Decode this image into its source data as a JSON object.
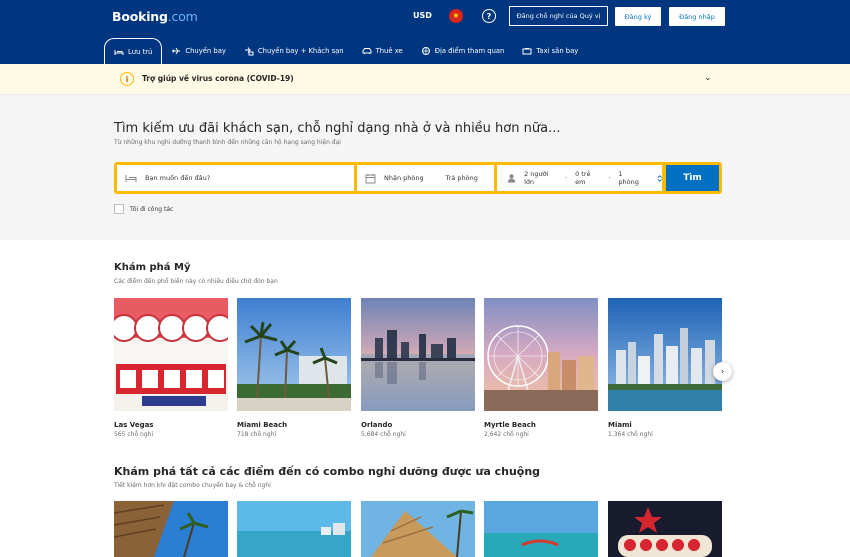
{
  "header": {
    "logo_main": "Booking",
    "logo_dot": ".com",
    "currency": "USD",
    "flag_glyph": "★",
    "help_glyph": "?",
    "list_property": "Đăng chỗ nghỉ của Quý vị",
    "register": "Đăng ký",
    "login": "Đăng nhập"
  },
  "nav": [
    {
      "label": "Lưu trú",
      "icon": "bed-icon"
    },
    {
      "label": "Chuyến bay",
      "icon": "plane-icon"
    },
    {
      "label": "Chuyến bay + Khách sạn",
      "icon": "plane-hotel-icon"
    },
    {
      "label": "Thuê xe",
      "icon": "car-icon"
    },
    {
      "label": "Địa điểm tham quan",
      "icon": "attractions-icon"
    },
    {
      "label": "Taxi sân bay",
      "icon": "taxi-icon"
    }
  ],
  "covid": {
    "icon_glyph": "i",
    "text": "Trợ giúp về virus corona (COVID-19)",
    "chevron": "⌄"
  },
  "hero": {
    "title": "Tìm kiếm ưu đãi khách sạn, chỗ nghỉ dạng nhà ở và nhiều hơn nữa...",
    "subtitle": "Từ những khu nghỉ dưỡng thanh bình đến những căn hộ hạng sang hiện đại"
  },
  "search": {
    "destination_placeholder": "Bạn muốn đến đâu?",
    "checkin": "Nhận phòng",
    "checkout": "Trả phòng",
    "adults": "2 người lớn",
    "children": "0 trẻ em",
    "rooms": "1 phòng",
    "separator": "·",
    "button": "Tìm",
    "business_trip": "Tôi đi công tác"
  },
  "explore": {
    "title": "Khám phá Mỹ",
    "subtitle": "Các điểm đến phổ biến này có nhiều điều chờ đón bạn",
    "next_glyph": "›",
    "cards": [
      {
        "name": "Las Vegas",
        "count": "565 chỗ nghỉ"
      },
      {
        "name": "Miami Beach",
        "count": "718 chỗ nghỉ"
      },
      {
        "name": "Orlando",
        "count": "5,684 chỗ nghỉ"
      },
      {
        "name": "Myrtle Beach",
        "count": "2,642 chỗ nghỉ"
      },
      {
        "name": "Miami",
        "count": "1,364 chỗ nghỉ"
      }
    ]
  },
  "combo": {
    "title": "Khám phá tất cả các điểm đến có combo nghỉ dưỡng được ưa chuộng",
    "subtitle": "Tiết kiệm hơn khi đặt combo chuyến bay & chỗ nghỉ"
  },
  "colors": {
    "brand_blue": "#003580",
    "action_blue": "#0071c2",
    "search_yellow": "#febb02",
    "covid_bg": "#fffae6"
  }
}
